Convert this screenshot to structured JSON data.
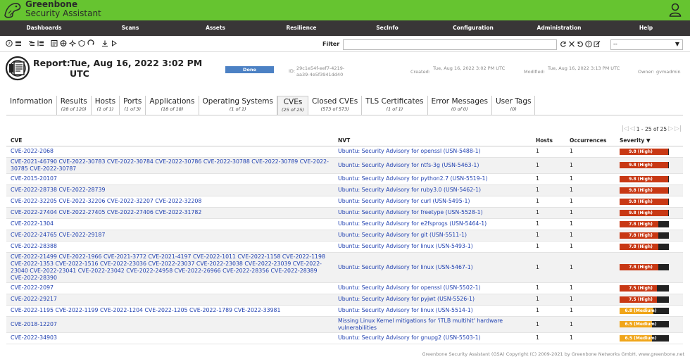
{
  "brand": {
    "line1": "Greenbone",
    "line2": "Security Assistant"
  },
  "menu": [
    "Dashboards",
    "Scans",
    "Assets",
    "Resilience",
    "SecInfo",
    "Configuration",
    "Administration",
    "Help"
  ],
  "toolbar": {
    "filter_label": "Filter",
    "filter_value": "",
    "select_value": "--",
    "tool_icons": [
      "help-icon",
      "list-icon",
      "delta-list-icon",
      "report-list-icon",
      "results-icon",
      "vulnerabilities-icon",
      "tls-icon",
      "download-icon",
      "play-icon"
    ],
    "filter_icons": [
      "refresh-icon",
      "clear-icon",
      "reset-icon",
      "help-icon",
      "edit-icon"
    ]
  },
  "report": {
    "title": "Report:",
    "date": "Tue, Aug 16, 2022 3:02 PM UTC",
    "status": "Done",
    "id_label": "ID:",
    "id_value": "29c1e54f-eef7-4219-aa39-4e5f3941dd40",
    "created_label": "Created:",
    "created_value": "Tue, Aug 16, 2022 3:02 PM UTC",
    "modified_label": "Modified:",
    "modified_value": "Tue, Aug 16, 2022 3:13 PM UTC",
    "owner_label": "Owner:",
    "owner_value": "gvmadmin"
  },
  "tabs": [
    {
      "label": "Information",
      "count": ""
    },
    {
      "label": "Results",
      "count": "(28 of 120)"
    },
    {
      "label": "Hosts",
      "count": "(1 of 1)"
    },
    {
      "label": "Ports",
      "count": "(1 of 3)"
    },
    {
      "label": "Applications",
      "count": "(18 of 18)"
    },
    {
      "label": "Operating Systems",
      "count": "(1 of 1)"
    },
    {
      "label": "CVEs",
      "count": "(25 of 25)"
    },
    {
      "label": "Closed CVEs",
      "count": "(573 of 573)"
    },
    {
      "label": "TLS Certificates",
      "count": "(1 of 1)"
    },
    {
      "label": "Error Messages",
      "count": "(0 of 0)"
    },
    {
      "label": "User Tags",
      "count": "(0)"
    }
  ],
  "pager": {
    "text": "1 - 25 of 25"
  },
  "columns": {
    "cve": "CVE",
    "nvt": "NVT",
    "hosts": "Hosts",
    "occurrences": "Occurrences",
    "severity": "Severity ▼"
  },
  "rows": [
    {
      "cve": "CVE-2022-2068",
      "nvt": "Ubuntu: Security Advisory for openssl (USN-5488-1)",
      "hosts": "1",
      "occ": "1",
      "sev": "9.8 (High)",
      "sev_value": 9.8,
      "sev_color": "#c83814"
    },
    {
      "cve": "CVE-2021-46790 CVE-2022-30783 CVE-2022-30784 CVE-2022-30786 CVE-2022-30788 CVE-2022-30789 CVE-2022-30785 CVE-2022-30787",
      "nvt": "Ubuntu: Security Advisory for ntfs-3g (USN-5463-1)",
      "hosts": "1",
      "occ": "1",
      "sev": "9.8 (High)",
      "sev_value": 9.8,
      "sev_color": "#c83814"
    },
    {
      "cve": "CVE-2015-20107",
      "nvt": "Ubuntu: Security Advisory for python2.7 (USN-5519-1)",
      "hosts": "1",
      "occ": "1",
      "sev": "9.8 (High)",
      "sev_value": 9.8,
      "sev_color": "#c83814"
    },
    {
      "cve": "CVE-2022-28738 CVE-2022-28739",
      "nvt": "Ubuntu: Security Advisory for ruby3.0 (USN-5462-1)",
      "hosts": "1",
      "occ": "1",
      "sev": "9.8 (High)",
      "sev_value": 9.8,
      "sev_color": "#c83814"
    },
    {
      "cve": "CVE-2022-32205 CVE-2022-32206 CVE-2022-32207 CVE-2022-32208",
      "nvt": "Ubuntu: Security Advisory for curl (USN-5495-1)",
      "hosts": "1",
      "occ": "1",
      "sev": "9.8 (High)",
      "sev_value": 9.8,
      "sev_color": "#c83814"
    },
    {
      "cve": "CVE-2022-27404 CVE-2022-27405 CVE-2022-27406 CVE-2022-31782",
      "nvt": "Ubuntu: Security Advisory for freetype (USN-5528-1)",
      "hosts": "1",
      "occ": "1",
      "sev": "9.8 (High)",
      "sev_value": 9.8,
      "sev_color": "#c83814"
    },
    {
      "cve": "CVE-2022-1304",
      "nvt": "Ubuntu: Security Advisory for e2fsprogs (USN-5464-1)",
      "hosts": "1",
      "occ": "1",
      "sev": "7.8 (High)",
      "sev_value": 7.8,
      "sev_color": "#c83814"
    },
    {
      "cve": "CVE-2022-24765 CVE-2022-29187",
      "nvt": "Ubuntu: Security Advisory for git (USN-5511-1)",
      "hosts": "1",
      "occ": "1",
      "sev": "7.8 (High)",
      "sev_value": 7.8,
      "sev_color": "#c83814"
    },
    {
      "cve": "CVE-2022-28388",
      "nvt": "Ubuntu: Security Advisory for linux (USN-5493-1)",
      "hosts": "1",
      "occ": "1",
      "sev": "7.8 (High)",
      "sev_value": 7.8,
      "sev_color": "#c83814"
    },
    {
      "cve": "CVE-2022-21499 CVE-2022-1966 CVE-2021-3772 CVE-2021-4197 CVE-2022-1011 CVE-2022-1158 CVE-2022-1198 CVE-2022-1353 CVE-2022-1516 CVE-2022-23036 CVE-2022-23037 CVE-2022-23038 CVE-2022-23039 CVE-2022-23040 CVE-2022-23041 CVE-2022-23042 CVE-2022-24958 CVE-2022-26966 CVE-2022-28356 CVE-2022-28389 CVE-2022-28390",
      "nvt": "Ubuntu: Security Advisory for linux (USN-5467-1)",
      "hosts": "1",
      "occ": "1",
      "sev": "7.8 (High)",
      "sev_value": 7.8,
      "sev_color": "#c83814"
    },
    {
      "cve": "CVE-2022-2097",
      "nvt": "Ubuntu: Security Advisory for openssl (USN-5502-1)",
      "hosts": "1",
      "occ": "1",
      "sev": "7.5 (High)",
      "sev_value": 7.5,
      "sev_color": "#c83814"
    },
    {
      "cve": "CVE-2022-29217",
      "nvt": "Ubuntu: Security Advisory for pyjwt (USN-5526-1)",
      "hosts": "1",
      "occ": "1",
      "sev": "7.5 (High)",
      "sev_value": 7.5,
      "sev_color": "#c83814"
    },
    {
      "cve": "CVE-2022-1195 CVE-2022-1199 CVE-2022-1204 CVE-2022-1205 CVE-2022-1789 CVE-2022-33981",
      "nvt": "Ubuntu: Security Advisory for linux (USN-5514-1)",
      "hosts": "1",
      "occ": "1",
      "sev": "6.8 (Medium)",
      "sev_value": 6.8,
      "sev_color": "#f0a519"
    },
    {
      "cve": "CVE-2018-12207",
      "nvt": "Missing Linux Kernel mitigations for 'iTLB multihit' hardware vulnerabilities",
      "hosts": "1",
      "occ": "1",
      "sev": "6.5 (Medium)",
      "sev_value": 6.5,
      "sev_color": "#f0a519"
    },
    {
      "cve": "CVE-2022-34903",
      "nvt": "Ubuntu: Security Advisory for gnupg2 (USN-5503-1)",
      "hosts": "1",
      "occ": "1",
      "sev": "6.5 (Medium)",
      "sev_value": 6.5,
      "sev_color": "#f0a519"
    }
  ],
  "footer": "Greenbone Security Assistant (GSA) Copyright (C) 2009-2021 by Greenbone Networks GmbH, www.greenbone.net"
}
